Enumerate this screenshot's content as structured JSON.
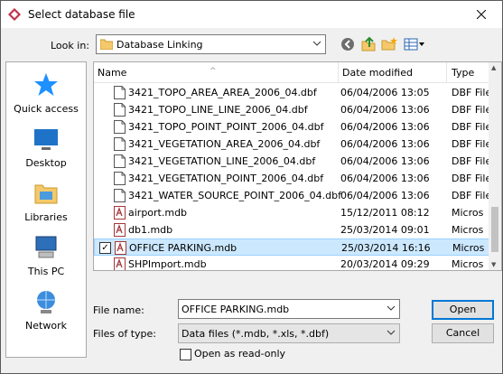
{
  "window": {
    "title": "Select database file"
  },
  "lookin": {
    "label": "Look in:",
    "value": "Database Linking"
  },
  "places": [
    {
      "label": "Quick access",
      "icon": "star-icon"
    },
    {
      "label": "Desktop",
      "icon": "desktop-icon"
    },
    {
      "label": "Libraries",
      "icon": "libraries-icon"
    },
    {
      "label": "This PC",
      "icon": "computer-icon"
    },
    {
      "label": "Network",
      "icon": "network-icon"
    }
  ],
  "columns": {
    "name": "Name",
    "date": "Date modified",
    "type": "Type"
  },
  "files": [
    {
      "name": "3421_TOPO_AREA_AREA_2006_04.dbf",
      "date": "06/04/2006 13:05",
      "type": "DBF File",
      "kind": "dbf"
    },
    {
      "name": "3421_TOPO_LINE_LINE_2006_04.dbf",
      "date": "06/04/2006 13:06",
      "type": "DBF File",
      "kind": "dbf"
    },
    {
      "name": "3421_TOPO_POINT_POINT_2006_04.dbf",
      "date": "06/04/2006 13:06",
      "type": "DBF File",
      "kind": "dbf"
    },
    {
      "name": "3421_VEGETATION_AREA_2006_04.dbf",
      "date": "06/04/2006 13:06",
      "type": "DBF File",
      "kind": "dbf"
    },
    {
      "name": "3421_VEGETATION_LINE_2006_04.dbf",
      "date": "06/04/2006 13:06",
      "type": "DBF File",
      "kind": "dbf"
    },
    {
      "name": "3421_VEGETATION_POINT_2006_04.dbf",
      "date": "06/04/2006 13:06",
      "type": "DBF File",
      "kind": "dbf"
    },
    {
      "name": "3421_WATER_SOURCE_POINT_2006_04.dbf",
      "date": "06/04/2006 13:06",
      "type": "DBF File",
      "kind": "dbf"
    },
    {
      "name": "airport.mdb",
      "date": "15/12/2011 08:12",
      "type": "Micros",
      "kind": "mdb"
    },
    {
      "name": "db1.mdb",
      "date": "25/03/2014 09:01",
      "type": "Micros",
      "kind": "mdb"
    },
    {
      "name": "OFFICE PARKING.mdb",
      "date": "25/03/2014 16:16",
      "type": "Micros",
      "kind": "mdb",
      "selected": true
    },
    {
      "name": "SHPImport.mdb",
      "date": "20/03/2014 09:29",
      "type": "Micros",
      "kind": "mdb"
    }
  ],
  "filename": {
    "label": "File name:",
    "value": "OFFICE PARKING.mdb"
  },
  "filetype": {
    "label": "Files of type:",
    "value": "Data files (*.mdb, *.xls, *.dbf)"
  },
  "readonly": {
    "label": "Open as read-only",
    "checked": false
  },
  "buttons": {
    "open": "Open",
    "cancel": "Cancel"
  }
}
